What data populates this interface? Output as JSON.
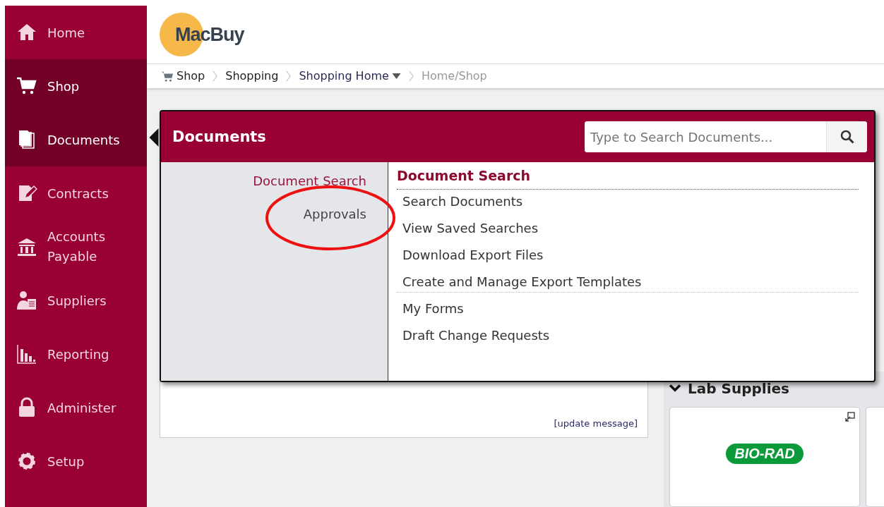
{
  "sidebar": {
    "items": [
      {
        "label": "Home",
        "selected": false
      },
      {
        "label": "Shop",
        "selected": true
      },
      {
        "label": "Documents",
        "selected": true
      },
      {
        "label": "Contracts",
        "selected": false
      },
      {
        "label": "Accounts Payable",
        "selected": false
      },
      {
        "label": "Suppliers",
        "selected": false
      },
      {
        "label": "Reporting",
        "selected": false
      },
      {
        "label": "Administer",
        "selected": false
      },
      {
        "label": "Setup",
        "selected": false
      }
    ]
  },
  "logo": {
    "text": "MacBuy"
  },
  "breadcrumb": [
    {
      "label": "Shop",
      "kind": "link"
    },
    {
      "label": "Shopping",
      "kind": "link"
    },
    {
      "label": "Shopping Home",
      "kind": "dropdown"
    },
    {
      "label": "Home/Shop",
      "kind": "current"
    }
  ],
  "flyout": {
    "title": "Documents",
    "search": {
      "placeholder": "Type to Search Documents..."
    },
    "categories": [
      {
        "label": "Document Search",
        "selected": true
      },
      {
        "label": "Approvals",
        "selected": false
      }
    ],
    "section_title": "Document Search",
    "groups": [
      [
        "Search Documents",
        "View Saved Searches",
        "Download Export Files",
        "Create and Manage Export Templates"
      ],
      [
        "My Forms",
        "Draft Change Requests"
      ]
    ]
  },
  "message_panel": {
    "link": "[update message]"
  },
  "lab_supplies": {
    "title": "Lab Supplies",
    "expanded": true,
    "cards": [
      {
        "logo": "BIO-RAD"
      }
    ]
  },
  "annotation": {
    "kind": "ellipse"
  }
}
